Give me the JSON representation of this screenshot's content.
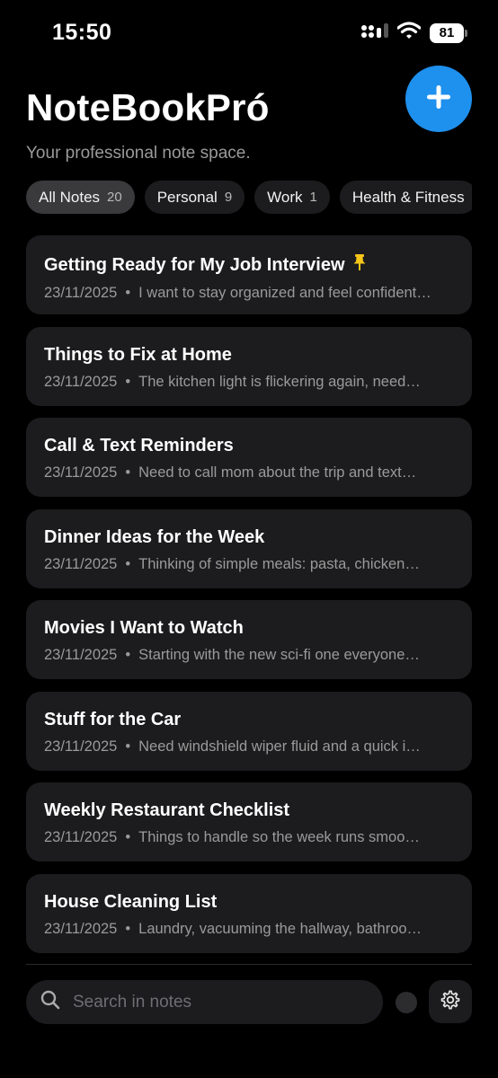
{
  "status_bar": {
    "time": "15:50",
    "battery": "81"
  },
  "header": {
    "title": "NoteBookPró",
    "subtitle": "Your professional note space."
  },
  "filters": [
    {
      "label": "All Notes",
      "count": "20"
    },
    {
      "label": "Personal",
      "count": "9"
    },
    {
      "label": "Work",
      "count": "1"
    },
    {
      "label": "Health & Fitness",
      "count": ""
    }
  ],
  "notes": [
    {
      "title": "Getting Ready for My Job Interview",
      "date": "23/11/2025",
      "preview": "I want to stay organized and feel confident…",
      "pinned": true
    },
    {
      "title": "Things to Fix at Home",
      "date": "23/11/2025",
      "preview": "The kitchen light is flickering again, need…"
    },
    {
      "title": "Call & Text Reminders",
      "date": "23/11/2025",
      "preview": "Need to call mom about the trip and text…"
    },
    {
      "title": "Dinner Ideas for the Week",
      "date": "23/11/2025",
      "preview": "Thinking of simple meals: pasta, chicken…"
    },
    {
      "title": "Movies I Want to Watch",
      "date": "23/11/2025",
      "preview": "Starting with the new sci-fi one everyone…"
    },
    {
      "title": "Stuff for the Car",
      "date": "23/11/2025",
      "preview": "Need windshield wiper fluid and a quick i…"
    },
    {
      "title": "Weekly Restaurant Checklist",
      "date": "23/11/2025",
      "preview": "Things to handle so the week runs smoo…"
    },
    {
      "title": "House Cleaning List",
      "date": "23/11/2025",
      "preview": "Laundry, vacuuming the hallway, bathroo…"
    }
  ],
  "search": {
    "placeholder": "Search in notes"
  },
  "colors": {
    "accent": "#1e90ee",
    "pin": "#f5c518",
    "card": "#1c1c1e"
  },
  "icons": {
    "add": "plus-icon",
    "pin": "pin-icon",
    "search": "search-icon",
    "settings": "gear-icon"
  }
}
